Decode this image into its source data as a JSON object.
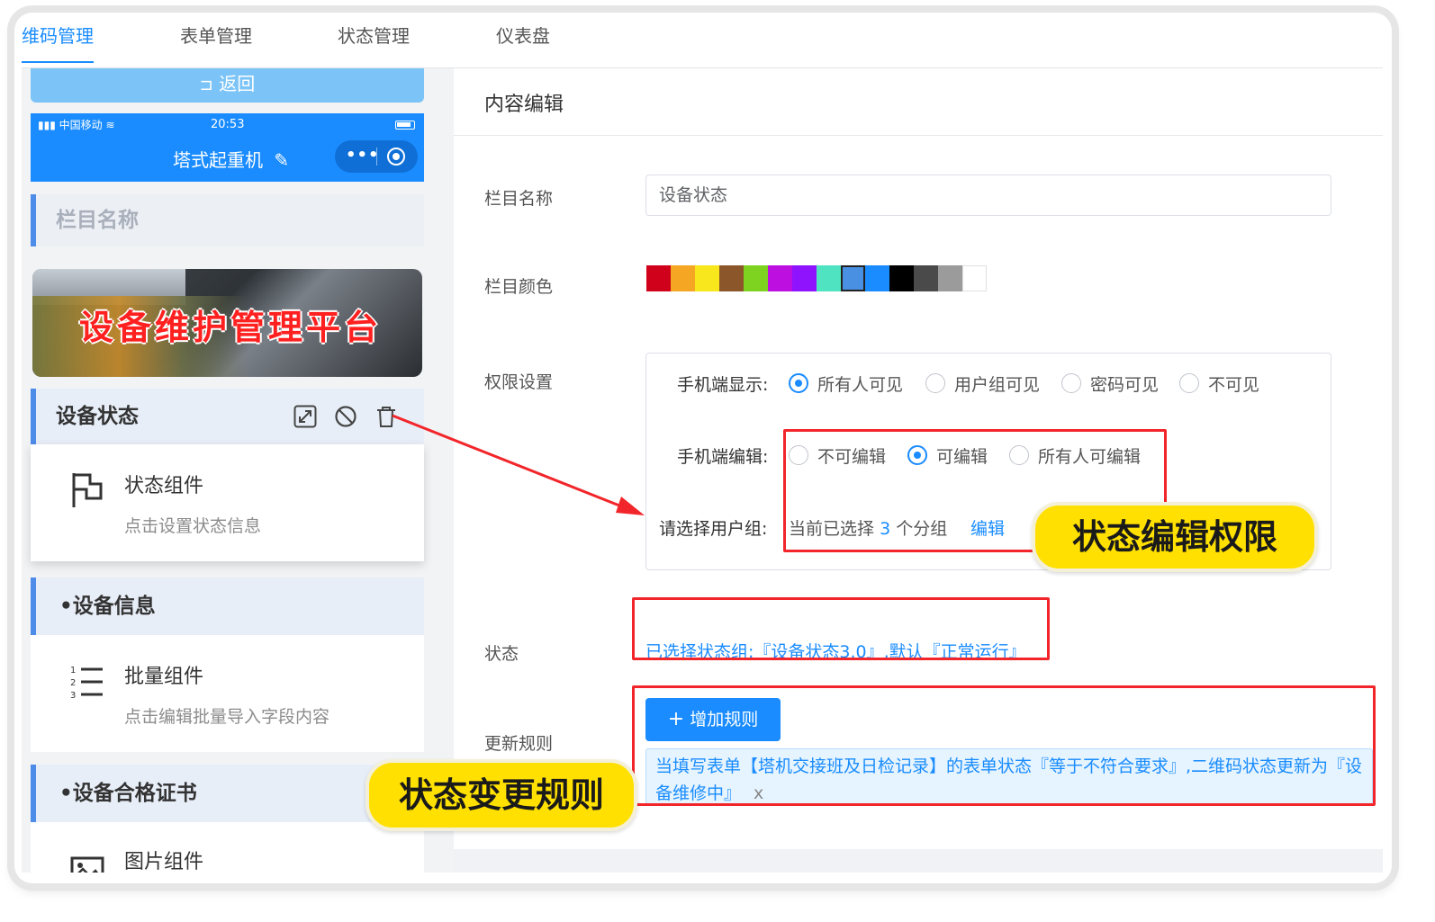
{
  "tabs": [
    {
      "label": "维码管理",
      "active": true
    },
    {
      "label": "表单管理",
      "active": false
    },
    {
      "label": "状态管理",
      "active": false
    },
    {
      "label": "仪表盘",
      "active": false
    }
  ],
  "left": {
    "back_label": "返回",
    "status_bar": {
      "carrier": "中国移动",
      "time": "20:53"
    },
    "phone_title": "塔式起重机",
    "sections": {
      "column_name_placeholder": "栏目名称",
      "banner_text": "设备维护管理平台",
      "device_status": {
        "title": "设备状态",
        "component_title": "状态组件",
        "component_sub": "点击设置状态信息"
      },
      "device_info": {
        "title": "•设备信息",
        "component_title": "批量组件",
        "component_sub": "点击编辑批量导入字段内容"
      },
      "device_cert": {
        "title": "•设备合格证书",
        "component_title": "图片组件"
      }
    }
  },
  "form": {
    "title": "内容编辑",
    "labels": {
      "name": "栏目名称",
      "color": "栏目颜色",
      "permission": "权限设置",
      "status": "状态",
      "rules": "更新规则"
    },
    "name_value": "设备状态",
    "colors": [
      "#d0021b",
      "#f5a623",
      "#f8e71c",
      "#8b572a",
      "#7ed321",
      "#bd10e0",
      "#9013fe",
      "#50e3c2",
      "#4a90e2",
      "#1a8cff",
      "#000000",
      "#4a4a4a",
      "#9b9b9b",
      "#ffffff"
    ],
    "selected_color": "#4a90e2",
    "mobile_display": {
      "label": "手机端显示:",
      "options": [
        "所有人可见",
        "用户组可见",
        "密码可见",
        "不可见"
      ],
      "selected": "所有人可见"
    },
    "mobile_edit": {
      "label": "手机端编辑:",
      "options": [
        "不可编辑",
        "可编辑",
        "所有人可编辑"
      ],
      "selected": "可编辑"
    },
    "user_group": {
      "label": "请选择用户组:",
      "prefix": "当前已选择",
      "count": "3",
      "suffix": "个分组",
      "edit_label": "编辑"
    },
    "status_text": "已选择状态组:『设备状态3.0』,默认『正常运行』",
    "add_rule_label": "增加规则",
    "rule_text": "当填写表单【塔机交接班及日检记录】的表单状态『等于不符合要求』,二维码状态更新为『设备维修中』",
    "rule_close": "x"
  },
  "callouts": {
    "edit_permission": "状态编辑权限",
    "change_rule": "状态变更规则"
  },
  "accent_colors": {
    "primary": "#1a8cff",
    "annotation_red": "#f2262a",
    "callout_yellow": "#ffe000"
  }
}
